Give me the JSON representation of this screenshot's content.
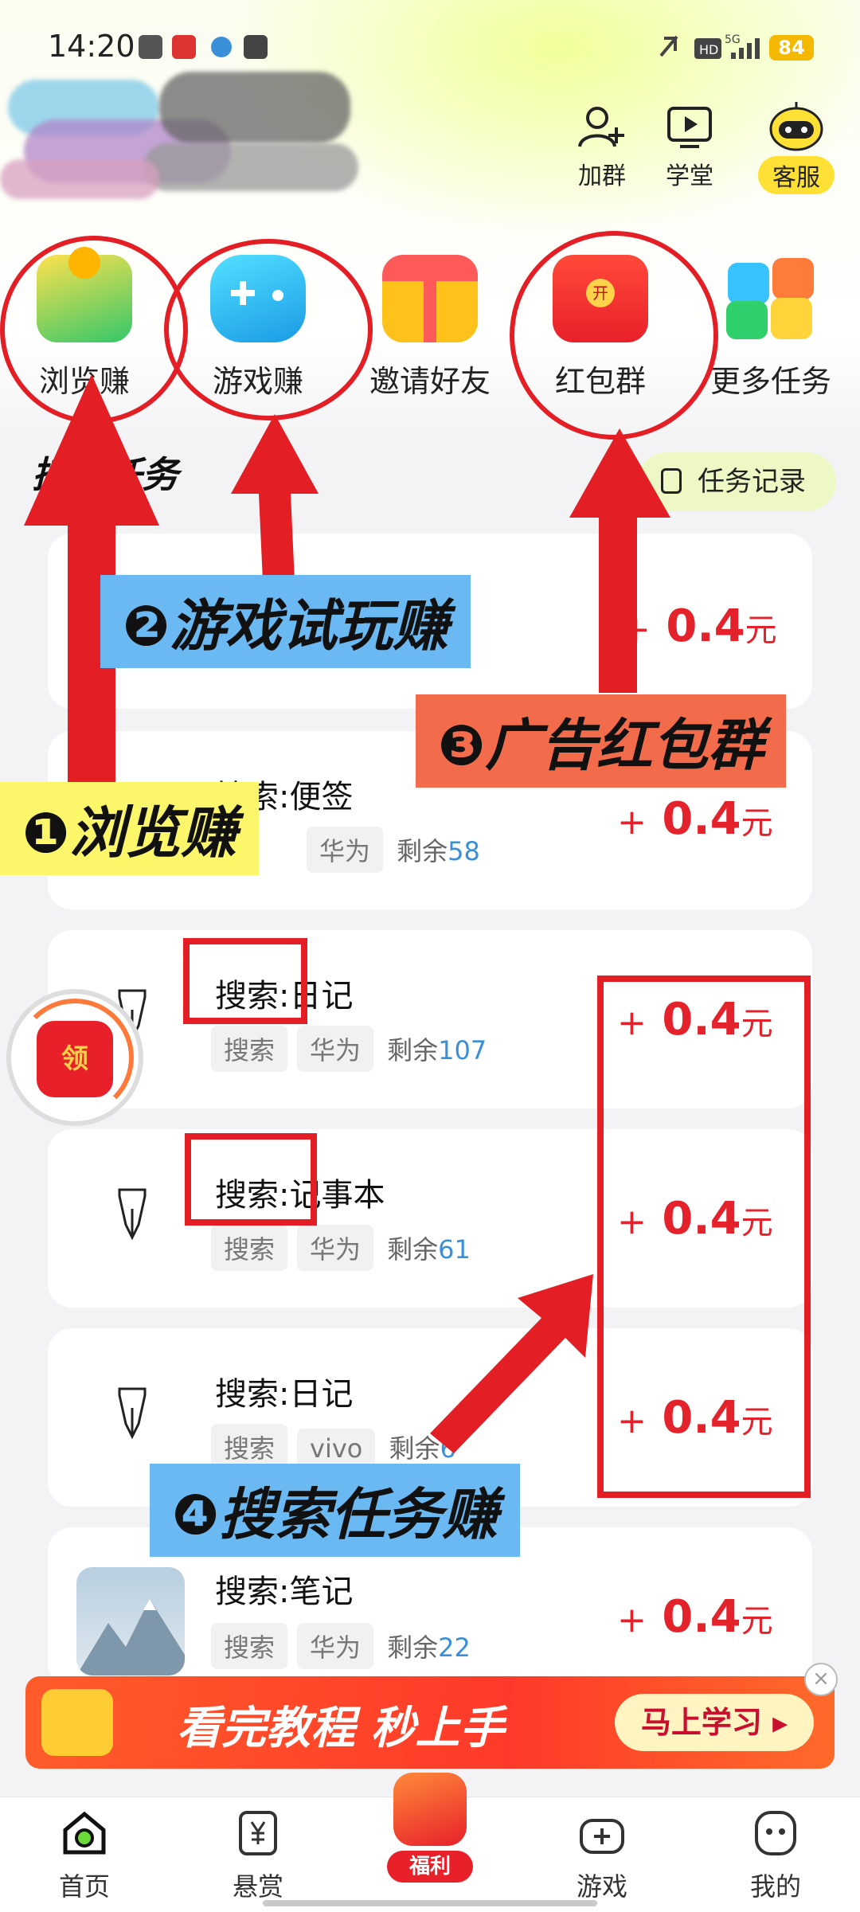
{
  "status_bar": {
    "time": "14:20",
    "battery": "84",
    "network": "5G"
  },
  "header": {
    "buttons": [
      {
        "label": "加群",
        "icon": "add-user-icon"
      },
      {
        "label": "学堂",
        "icon": "play-screen-icon"
      },
      {
        "label": "客服",
        "icon": "robot-icon"
      }
    ]
  },
  "categories": [
    {
      "label": "浏览赚",
      "icon": "wallet-coins-icon"
    },
    {
      "label": "游戏赚",
      "icon": "gamepad-icon"
    },
    {
      "label": "邀请好友",
      "icon": "gift-box-icon"
    },
    {
      "label": "红包群",
      "icon": "red-envelope-icon"
    },
    {
      "label": "更多任务",
      "icon": "grid-tiles-icon"
    }
  ],
  "section": {
    "title": "搜索任务",
    "record_label": "任务记录"
  },
  "tasks": [
    {
      "title": "",
      "tags": [],
      "remain_prefix": "",
      "remain": "",
      "reward_plus": "+",
      "reward_value": "0.4",
      "reward_unit": "元"
    },
    {
      "title": "搜索:便签",
      "tags": [
        "华为"
      ],
      "remain_prefix": "剩余",
      "remain": "58",
      "reward_plus": "+",
      "reward_value": "0.4",
      "reward_unit": "元"
    },
    {
      "title": "搜索:日记",
      "tags": [
        "搜索",
        "华为"
      ],
      "remain_prefix": "剩余",
      "remain": "107",
      "reward_plus": "+",
      "reward_value": "0.4",
      "reward_unit": "元"
    },
    {
      "title": "搜索:记事本",
      "tags": [
        "搜索",
        "华为"
      ],
      "remain_prefix": "剩余",
      "remain": "61",
      "reward_plus": "+",
      "reward_value": "0.4",
      "reward_unit": "元"
    },
    {
      "title": "搜索:日记",
      "tags": [
        "搜索",
        "vivo"
      ],
      "remain_prefix": "剩余",
      "remain": "6",
      "reward_plus": "+",
      "reward_value": "0.4",
      "reward_unit": "元"
    },
    {
      "title": "搜索:笔记",
      "tags": [
        "搜索",
        "华为"
      ],
      "remain_prefix": "剩余",
      "remain": "22",
      "reward_plus": "+",
      "reward_value": "0.4",
      "reward_unit": "元"
    }
  ],
  "annotations": {
    "a1": "❶浏览赚",
    "a2": "❷游戏试玩赚",
    "a3": "❸广告红包群",
    "a4": "❹搜索任务赚"
  },
  "floating_badge": {
    "label": "领"
  },
  "promo": {
    "text": "看完教程 秒上手",
    "button": "马上学习"
  },
  "bottom_nav": [
    {
      "label": "首页",
      "icon": "home-icon"
    },
    {
      "label": "悬赏",
      "icon": "yuan-doc-icon"
    },
    {
      "label": "福利",
      "icon": "welfare-mascot-icon"
    },
    {
      "label": "游戏",
      "icon": "gamepad-icon"
    },
    {
      "label": "我的",
      "icon": "profile-face-icon"
    }
  ],
  "colors": {
    "accent_red": "#e31e24",
    "reward_red": "#e3222b",
    "remain_blue": "#3a8fd9",
    "yellow": "#ffe135"
  }
}
